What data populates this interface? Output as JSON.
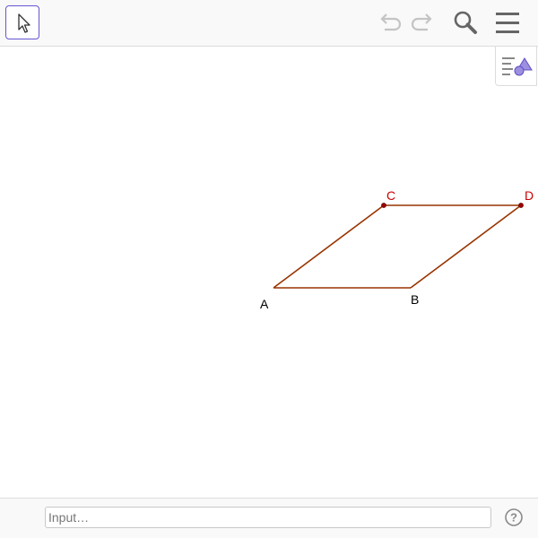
{
  "toolbar": {
    "active_tool_icon": "move-arrow-icon",
    "undo_icon": "undo-icon",
    "redo_icon": "redo-icon",
    "search_icon": "search-icon",
    "menu_icon": "hamburger-menu-icon"
  },
  "graphics": {
    "style_bar_icon": "graphics-style-icon",
    "points": [
      {
        "name": "A",
        "color": "#000000"
      },
      {
        "name": "B",
        "color": "#000000"
      },
      {
        "name": "C",
        "color": "#cc0000"
      },
      {
        "name": "D",
        "color": "#cc0000"
      }
    ],
    "segment_color": "#993300",
    "point_color": "#990000"
  },
  "input_bar": {
    "placeholder": "Input…",
    "value": "",
    "help_icon": "help-icon"
  },
  "colors": {
    "accent": "#6557d2",
    "toolbar_bg": "#f9f9f9",
    "icon_gray": "#666666"
  }
}
